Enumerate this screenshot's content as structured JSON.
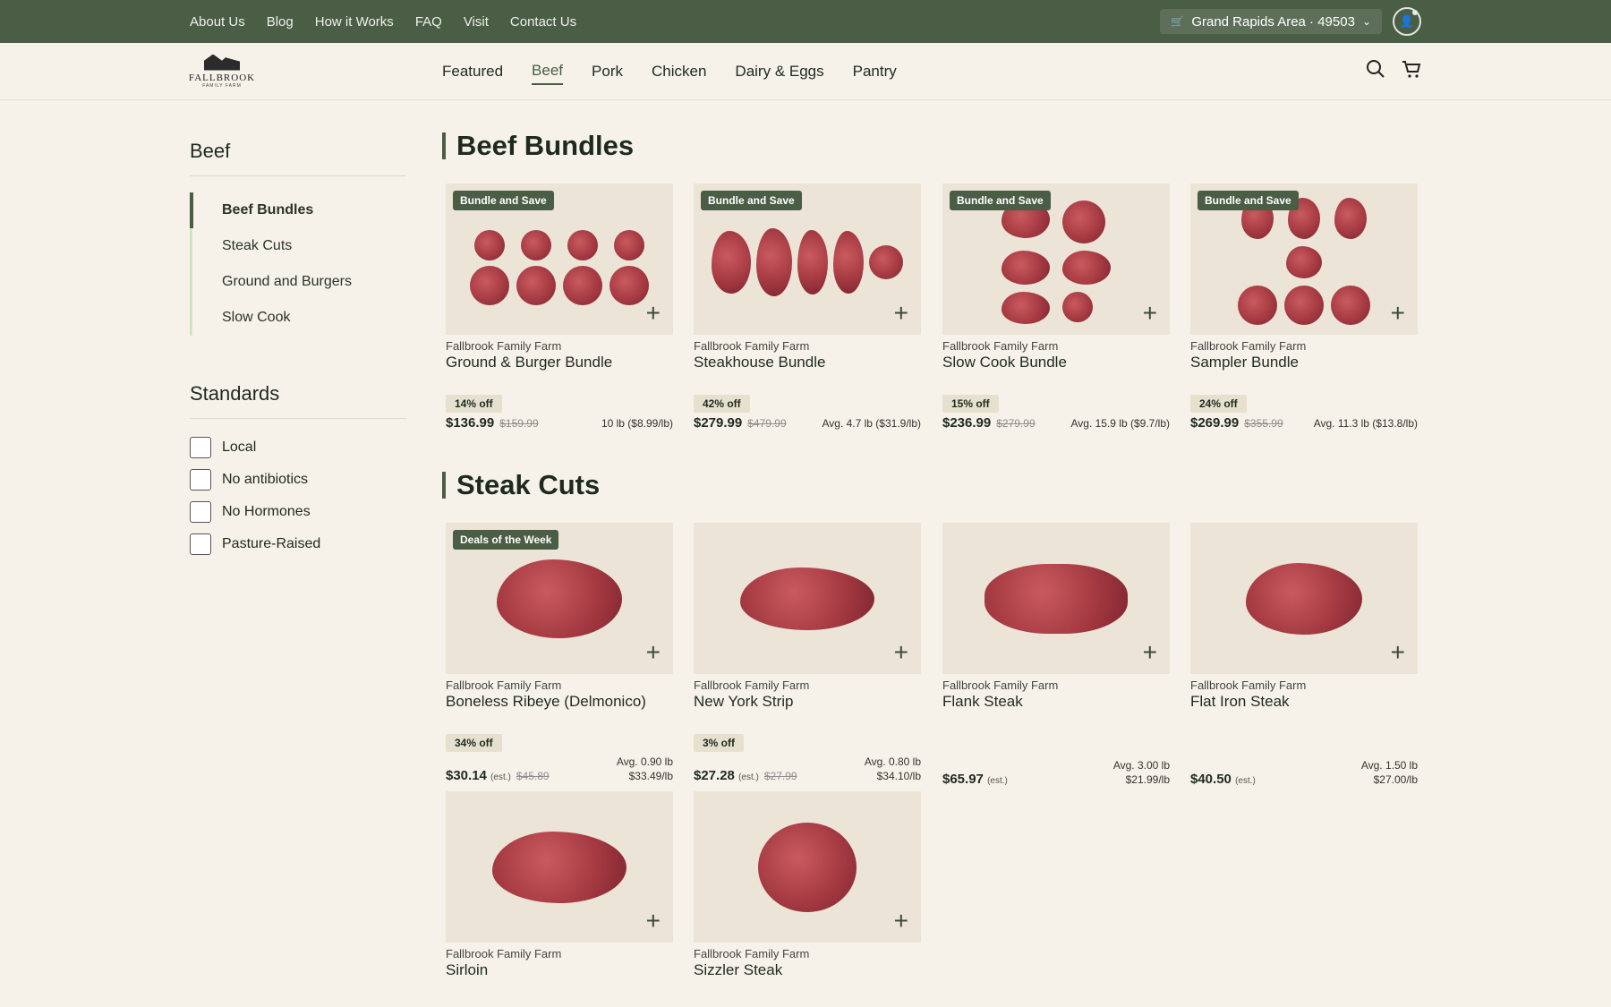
{
  "topbar": {
    "links": [
      "About Us",
      "Blog",
      "How it Works",
      "FAQ",
      "Visit",
      "Contact Us"
    ],
    "location": "Grand Rapids Area · 49503"
  },
  "logo": {
    "name": "FALLBROOK",
    "sub": "FAMILY FARM"
  },
  "nav": {
    "categories": [
      "Featured",
      "Beef",
      "Pork",
      "Chicken",
      "Dairy & Eggs",
      "Pantry"
    ],
    "active": "Beef"
  },
  "sidebar": {
    "title": "Beef",
    "items": [
      "Beef Bundles",
      "Steak Cuts",
      "Ground and Burgers",
      "Slow Cook"
    ],
    "standards_title": "Standards",
    "standards": [
      "Local",
      "No antibiotics",
      "No Hormones",
      "Pasture-Raised"
    ]
  },
  "sections": [
    {
      "title": "Beef Bundles",
      "products": [
        {
          "badge": "Bundle and Save",
          "farm": "Fallbrook Family Farm",
          "name": "Ground & Burger Bundle",
          "off": "14% off",
          "price": "$136.99",
          "est": "",
          "orig": "$159.99",
          "weight1": "10 lb ($8.99/lb)",
          "weight2": ""
        },
        {
          "badge": "Bundle and Save",
          "farm": "Fallbrook Family Farm",
          "name": "Steakhouse Bundle",
          "off": "42% off",
          "price": "$279.99",
          "est": "",
          "orig": "$479.99",
          "weight1": "Avg. 4.7 lb ($31.9/lb)",
          "weight2": ""
        },
        {
          "badge": "Bundle and Save",
          "farm": "Fallbrook Family Farm",
          "name": "Slow Cook Bundle",
          "off": "15% off",
          "price": "$236.99",
          "est": "",
          "orig": "$279.99",
          "weight1": "Avg. 15.9 lb ($9.7/lb)",
          "weight2": ""
        },
        {
          "badge": "Bundle and Save",
          "farm": "Fallbrook Family Farm",
          "name": "Sampler Bundle",
          "off": "24% off",
          "price": "$269.99",
          "est": "",
          "orig": "$355.99",
          "weight1": "Avg. 11.3 lb ($13.8/lb)",
          "weight2": ""
        }
      ]
    },
    {
      "title": "Steak Cuts",
      "products": [
        {
          "badge": "Deals of the Week",
          "farm": "Fallbrook Family Farm",
          "name": "Boneless Ribeye (Delmonico)",
          "off": "34% off",
          "price": "$30.14",
          "est": "(est.)",
          "orig": "$45.89",
          "weight1": "Avg. 0.90 lb",
          "weight2": "$33.49/lb"
        },
        {
          "badge": "",
          "farm": "Fallbrook Family Farm",
          "name": "New York Strip",
          "off": "3% off",
          "price": "$27.28",
          "est": "(est.)",
          "orig": "$27.99",
          "weight1": "Avg. 0.80 lb",
          "weight2": "$34.10/lb"
        },
        {
          "badge": "",
          "farm": "Fallbrook Family Farm",
          "name": "Flank Steak",
          "off": "",
          "price": "$65.97",
          "est": "(est.)",
          "orig": "",
          "weight1": "Avg. 3.00 lb",
          "weight2": "$21.99/lb"
        },
        {
          "badge": "",
          "farm": "Fallbrook Family Farm",
          "name": "Flat Iron Steak",
          "off": "",
          "price": "$40.50",
          "est": "(est.)",
          "orig": "",
          "weight1": "Avg. 1.50 lb",
          "weight2": "$27.00/lb"
        },
        {
          "badge": "",
          "farm": "Fallbrook Family Farm",
          "name": "Sirloin",
          "off": "",
          "price": "",
          "est": "",
          "orig": "",
          "weight1": "",
          "weight2": ""
        },
        {
          "badge": "",
          "farm": "Fallbrook Family Farm",
          "name": "Sizzler Steak",
          "off": "",
          "price": "",
          "est": "",
          "orig": "",
          "weight1": "",
          "weight2": ""
        }
      ]
    }
  ]
}
